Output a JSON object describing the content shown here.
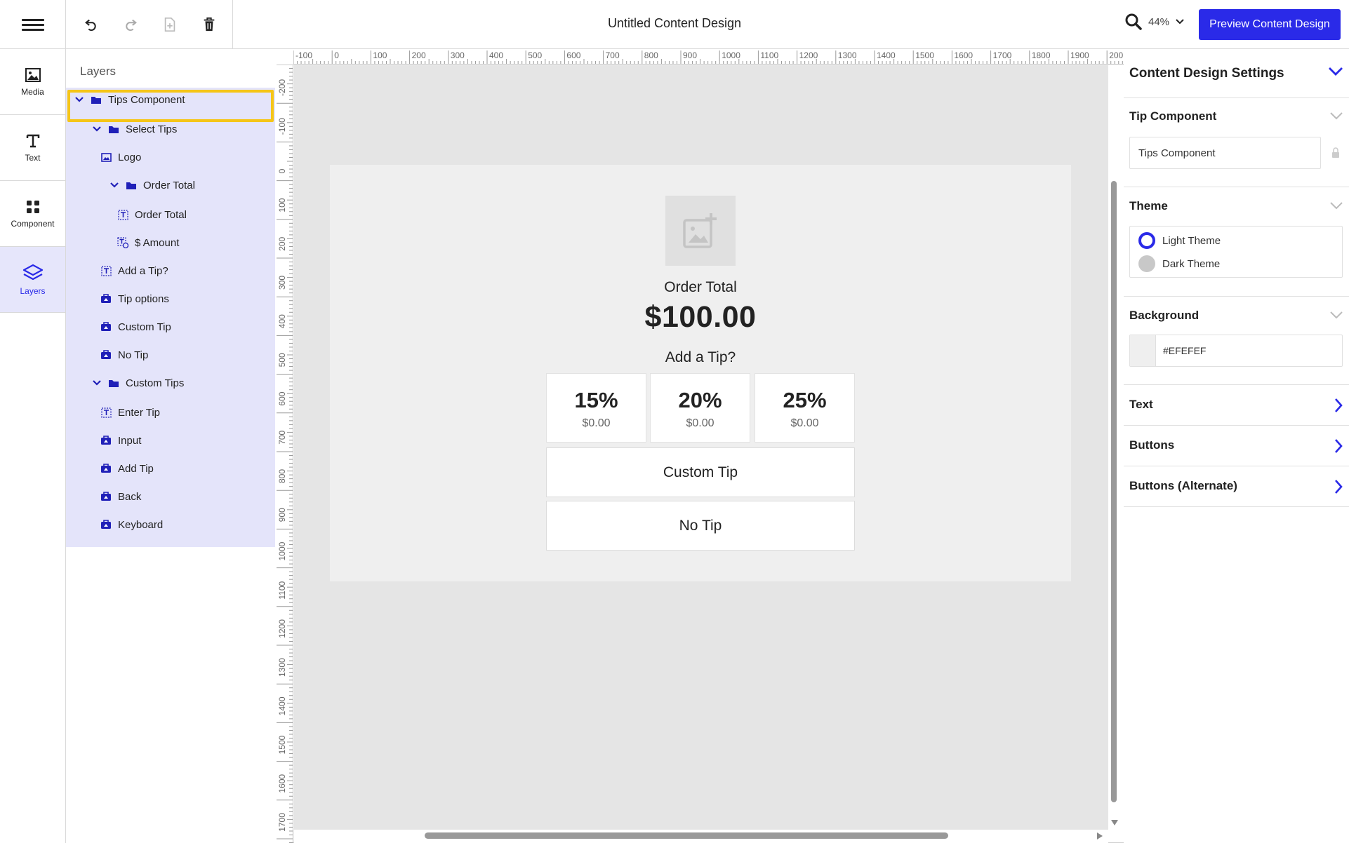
{
  "app": {
    "document_title": "Untitled Content Design",
    "zoom_level": "44%",
    "preview_button_label": "Preview Content Design"
  },
  "rail": [
    {
      "label": "Media",
      "icon": "image-icon"
    },
    {
      "label": "Text",
      "icon": "text-t-icon"
    },
    {
      "label": "Component",
      "icon": "grid-icon"
    },
    {
      "label": "Layers",
      "icon": "layers-icon"
    }
  ],
  "layers": {
    "title": "Layers",
    "items": [
      {
        "label": "Tips Component",
        "type": "folder",
        "expanded": true
      },
      {
        "label": "Select Tips",
        "type": "folder",
        "expanded": true
      },
      {
        "label": "Logo",
        "type": "image"
      },
      {
        "label": "Order Total",
        "type": "folder",
        "expanded": true
      },
      {
        "label": "Order Total",
        "type": "text"
      },
      {
        "label": "$ Amount",
        "type": "dynamic-text"
      },
      {
        "label": "Add a Tip?",
        "type": "text"
      },
      {
        "label": "Tip options",
        "type": "component"
      },
      {
        "label": "Custom Tip",
        "type": "component"
      },
      {
        "label": "No Tip",
        "type": "component"
      },
      {
        "label": "Custom Tips",
        "type": "folder",
        "expanded": true
      },
      {
        "label": "Enter Tip",
        "type": "text"
      },
      {
        "label": "Input",
        "type": "component"
      },
      {
        "label": "Add Tip",
        "type": "component"
      },
      {
        "label": "Back",
        "type": "component"
      },
      {
        "label": "Keyboard",
        "type": "component"
      }
    ]
  },
  "rulers": {
    "horizontal": [
      "-100",
      "0",
      "100",
      "200",
      "300",
      "400",
      "500",
      "600",
      "700",
      "800",
      "900",
      "1000",
      "1100",
      "1200",
      "1300",
      "1400",
      "1500",
      "1600",
      "1700",
      "1800",
      "1900",
      "200"
    ],
    "vertical": [
      "-200",
      "-100",
      "0",
      "100",
      "200",
      "300",
      "400",
      "500",
      "600",
      "700",
      "800",
      "900",
      "1000",
      "1100",
      "1200",
      "1300",
      "1400",
      "1500",
      "1600",
      "1700",
      "0"
    ]
  },
  "design": {
    "background_color": "#EFEFEF",
    "order_total_label": "Order Total",
    "order_total_amount": "$100.00",
    "add_tip_label": "Add a Tip?",
    "tip_options": [
      {
        "percent": "15%",
        "amount": "$0.00"
      },
      {
        "percent": "20%",
        "amount": "$0.00"
      },
      {
        "percent": "25%",
        "amount": "$0.00"
      }
    ],
    "custom_tip_label": "Custom Tip",
    "no_tip_label": "No Tip"
  },
  "settings": {
    "title": "Content Design Settings",
    "tip_component": {
      "title": "Tip Component",
      "name_value": "Tips Component"
    },
    "theme": {
      "title": "Theme",
      "options": [
        "Light Theme",
        "Dark Theme"
      ],
      "selected": "Light Theme"
    },
    "background": {
      "title": "Background",
      "value": "#EFEFEF"
    },
    "links": [
      "Text",
      "Buttons",
      "Buttons (Alternate)"
    ]
  },
  "colors": {
    "accent": "#2a2ae8",
    "layers_highlight": "#e4e4fa",
    "selection_outline": "#f5c518"
  }
}
